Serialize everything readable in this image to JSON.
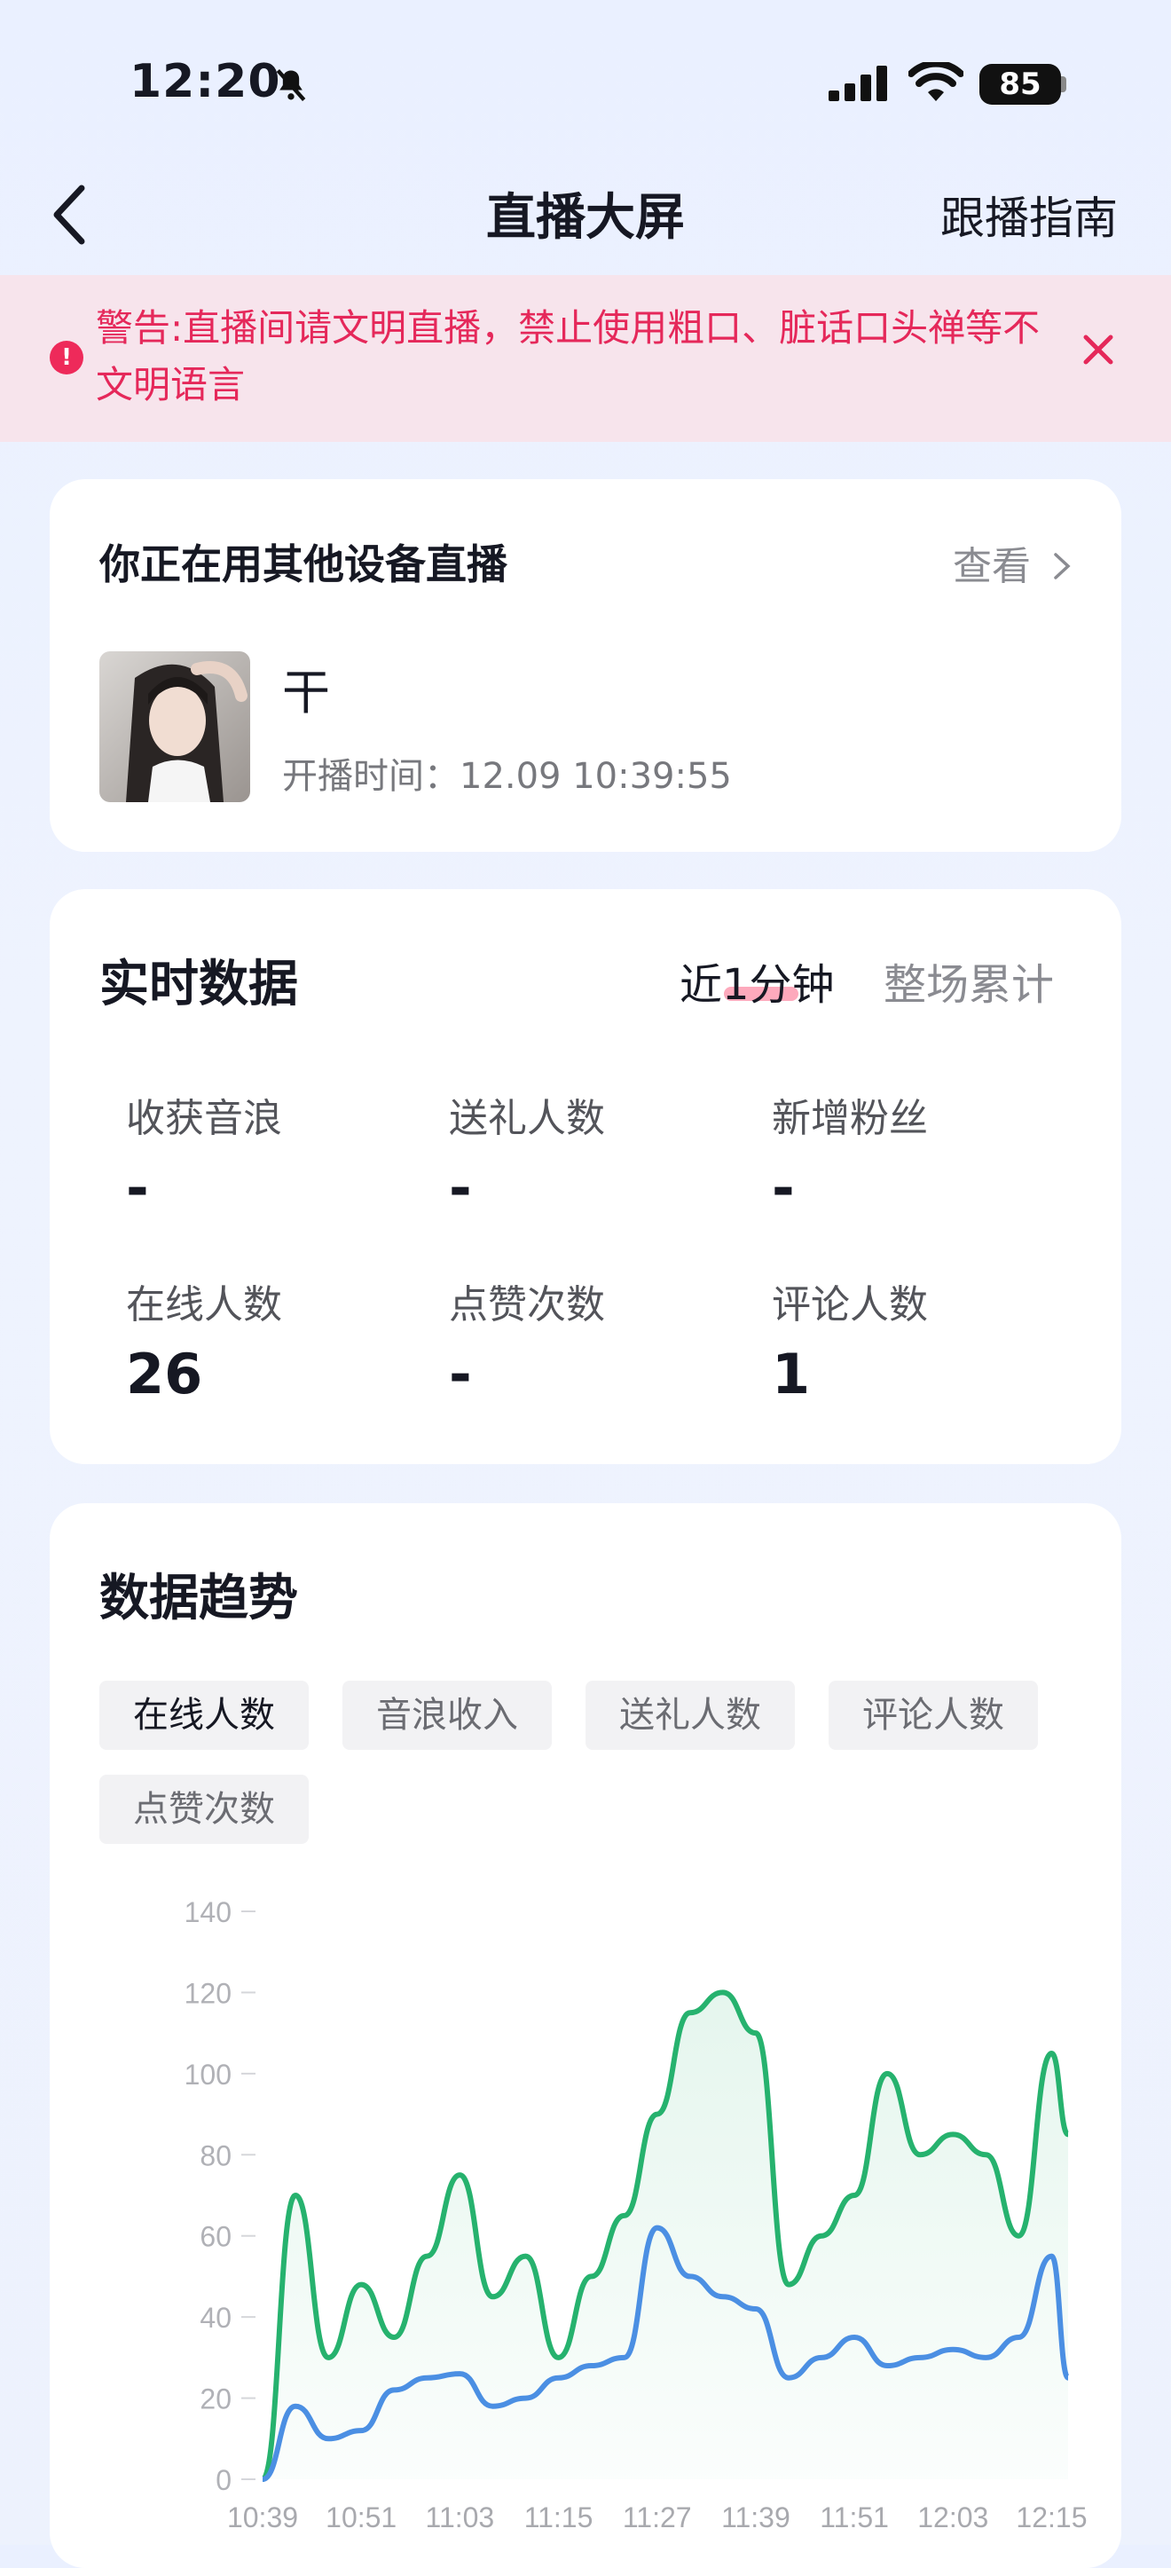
{
  "status_bar": {
    "time": "12:20",
    "battery": "85"
  },
  "nav": {
    "title": "直播大屏",
    "guide": "跟播指南"
  },
  "warning": {
    "text": "警告:直播间请文明直播，禁止使用粗口、脏话口头禅等不文明语言",
    "icon": "!"
  },
  "device_card": {
    "title": "你正在用其他设备直播",
    "view": "查看",
    "streamer_name": "干",
    "start_time": "开播时间：12.09 10:39:55"
  },
  "realtime": {
    "title": "实时数据",
    "tabs": [
      "近1分钟",
      "整场累计"
    ],
    "active_tab": "近1分钟",
    "metrics": [
      {
        "label": "收获音浪",
        "value": "-"
      },
      {
        "label": "送礼人数",
        "value": "-"
      },
      {
        "label": "新增粉丝",
        "value": "-"
      },
      {
        "label": "在线人数",
        "value": "26"
      },
      {
        "label": "点赞次数",
        "value": "-"
      },
      {
        "label": "评论人数",
        "value": "1"
      }
    ]
  },
  "trend": {
    "title": "数据趋势",
    "chips": [
      "在线人数",
      "音浪收入",
      "送礼人数",
      "评论人数",
      "点赞次数"
    ],
    "active_chip": "在线人数"
  },
  "chart_data": {
    "type": "line",
    "x": [
      "10:39",
      "10:43",
      "10:47",
      "10:51",
      "10:55",
      "10:59",
      "11:03",
      "11:07",
      "11:11",
      "11:15",
      "11:19",
      "11:23",
      "11:27",
      "11:31",
      "11:35",
      "11:39",
      "11:43",
      "11:47",
      "11:51",
      "11:55",
      "11:59",
      "12:03",
      "12:07",
      "12:11",
      "12:15",
      "12:17"
    ],
    "xticks": [
      "10:39",
      "10:51",
      "11:03",
      "11:15",
      "11:27",
      "11:39",
      "11:51",
      "12:03",
      "12:15"
    ],
    "yticks": [
      0,
      20,
      40,
      60,
      80,
      100,
      120,
      140
    ],
    "ylim": [
      0,
      140
    ],
    "series": [
      {
        "values": [
          0,
          70,
          30,
          48,
          35,
          55,
          75,
          45,
          55,
          30,
          50,
          65,
          90,
          115,
          120,
          110,
          48,
          60,
          70,
          100,
          80,
          85,
          80,
          60,
          105,
          85
        ],
        "color": "#26b26e"
      },
      {
        "values": [
          0,
          18,
          10,
          12,
          22,
          25,
          26,
          18,
          20,
          25,
          28,
          30,
          62,
          50,
          45,
          42,
          25,
          30,
          35,
          28,
          30,
          32,
          30,
          35,
          55,
          25
        ],
        "color": "#4b8fe3"
      }
    ]
  }
}
